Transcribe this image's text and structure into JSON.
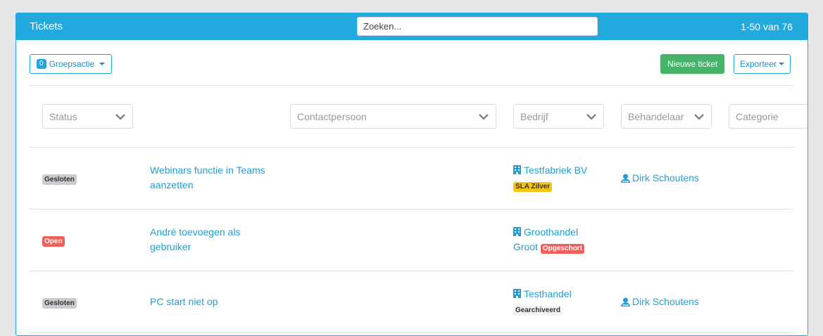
{
  "header": {
    "title": "Tickets",
    "search_placeholder": "Zoeken...",
    "count": "1-50 van 76"
  },
  "toolbar": {
    "group_action_count": "0",
    "group_action_label": "Groepsactie",
    "new_ticket_label": "Nieuwe ticket",
    "export_label": "Exporteer"
  },
  "filters": {
    "status": "Status",
    "contact": "Contactpersoon",
    "company": "Bedrijf",
    "handler": "Behandelaar",
    "category": "Categorie"
  },
  "rows": [
    {
      "status": "Gesloten",
      "subject": "Webinars functie in Teams aanzetten",
      "company": "Testfabriek BV",
      "company_tag": "SLA Zilver",
      "handler": "Dirk Schoutens"
    },
    {
      "status": "Open",
      "subject": "André toevoegen als gebruiker",
      "company_line1": "Groothandel",
      "company_line2": "Groot",
      "company_tag": "Opgeschort",
      "handler": ""
    },
    {
      "status": "Gesloten",
      "subject": "PC start niet op",
      "company": "Testhandel",
      "company_tag": "Gearchiveerd",
      "handler": "Dirk Schoutens"
    }
  ],
  "colors": {
    "header_blue": "#22a9de",
    "link_blue": "#1f9ed6",
    "new_button_green": "#45b36a",
    "status_open_red": "#f0605a",
    "sla_yellow": "#f3c412"
  }
}
